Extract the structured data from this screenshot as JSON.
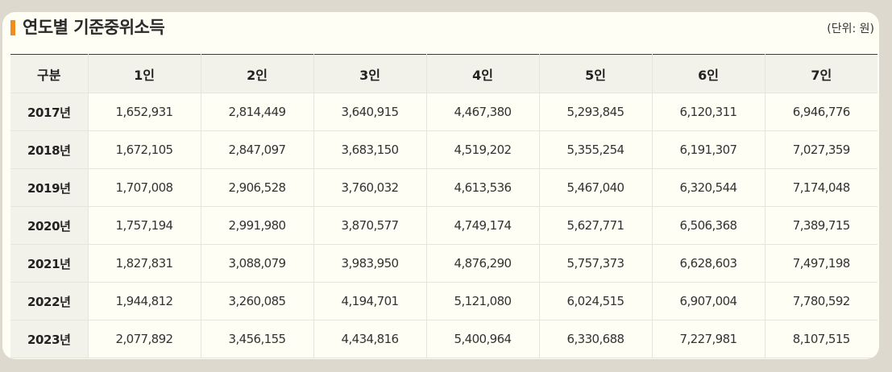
{
  "header": {
    "title": "연도별 기준중위소득",
    "unit": "(단위: 원)"
  },
  "table": {
    "columns": [
      "구분",
      "1인",
      "2인",
      "3인",
      "4인",
      "5인",
      "6인",
      "7인"
    ],
    "rows": [
      {
        "label": "2017년",
        "cells": [
          "1,652,931",
          "2,814,449",
          "3,640,915",
          "4,467,380",
          "5,293,845",
          "6,120,311",
          "6,946,776"
        ]
      },
      {
        "label": "2018년",
        "cells": [
          "1,672,105",
          "2,847,097",
          "3,683,150",
          "4,519,202",
          "5,355,254",
          "6,191,307",
          "7,027,359"
        ]
      },
      {
        "label": "2019년",
        "cells": [
          "1,707,008",
          "2,906,528",
          "3,760,032",
          "4,613,536",
          "5,467,040",
          "6,320,544",
          "7,174,048"
        ]
      },
      {
        "label": "2020년",
        "cells": [
          "1,757,194",
          "2,991,980",
          "3,870,577",
          "4,749,174",
          "5,627,771",
          "6,506,368",
          "7,389,715"
        ]
      },
      {
        "label": "2021년",
        "cells": [
          "1,827,831",
          "3,088,079",
          "3,983,950",
          "4,876,290",
          "5,757,373",
          "6,628,603",
          "7,497,198"
        ]
      },
      {
        "label": "2022년",
        "cells": [
          "1,944,812",
          "3,260,085",
          "4,194,701",
          "5,121,080",
          "6,024,515",
          "6,907,004",
          "7,780,592"
        ]
      },
      {
        "label": "2023년",
        "cells": [
          "2,077,892",
          "3,456,155",
          "4,434,816",
          "5,400,964",
          "6,330,688",
          "7,227,981",
          "8,107,515"
        ]
      }
    ]
  },
  "colors": {
    "accent": "#f08c1e",
    "card_background": "#fefef5",
    "page_background": "#ddd9ce",
    "header_cell_background": "#f2f2ea"
  }
}
